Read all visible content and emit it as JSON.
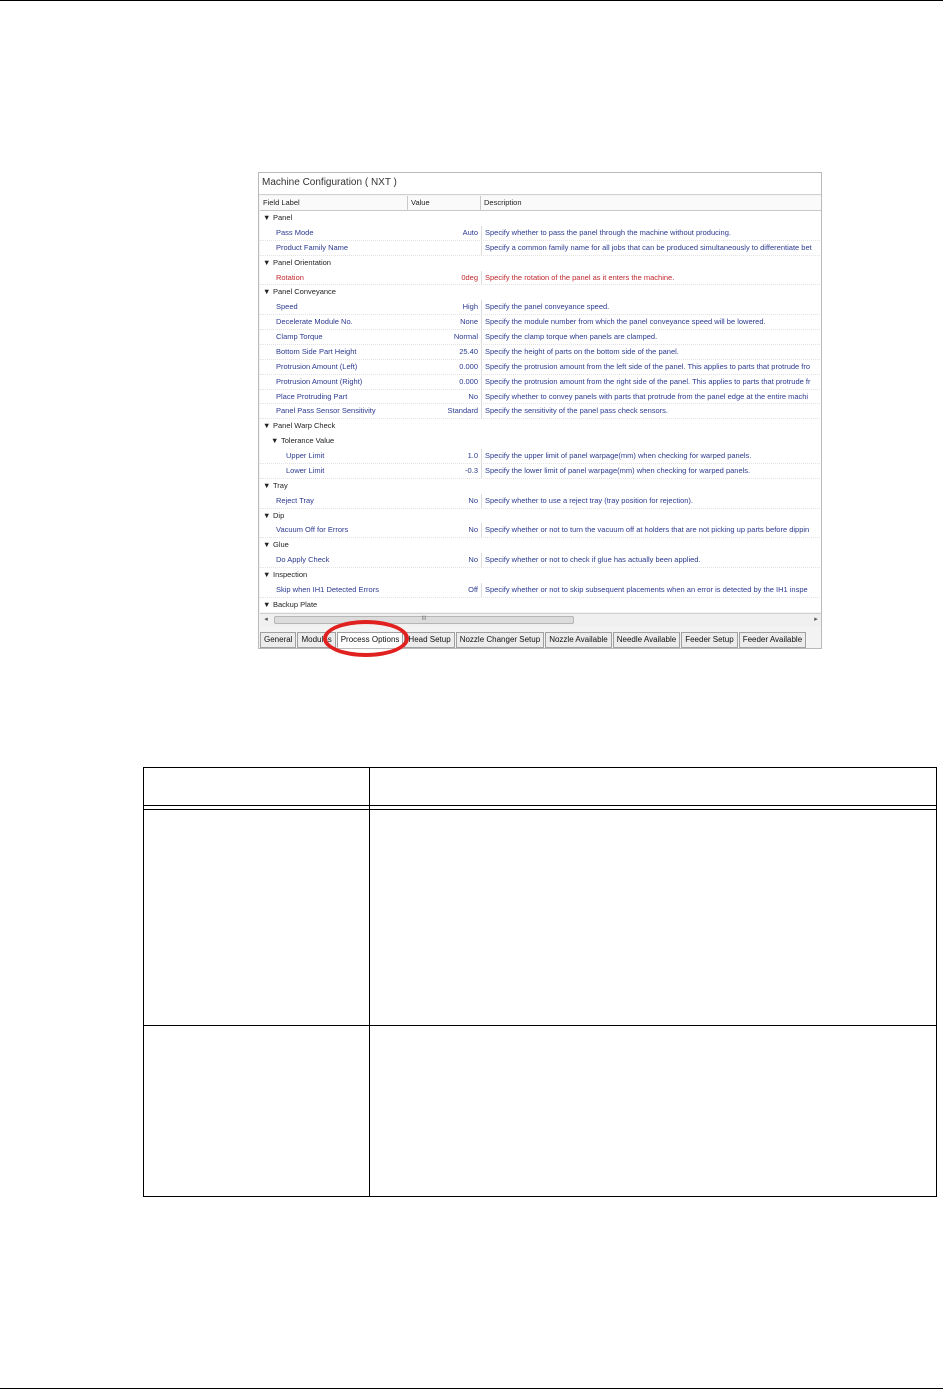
{
  "window": {
    "title": "Machine Configuration ( NXT )",
    "columns": [
      "Field Label",
      "Value",
      "Description"
    ]
  },
  "rows": [
    {
      "type": "category",
      "label": "Panel"
    },
    {
      "type": "property",
      "label": "Pass Mode",
      "value": "Auto",
      "description": "Specify whether to pass the panel through the machine without producing."
    },
    {
      "type": "property",
      "label": "Product Family Name",
      "value": "",
      "description": "Specify a common family name for all jobs that can be produced simultaneously to differentiate bet"
    },
    {
      "type": "category",
      "label": "Panel Orientation"
    },
    {
      "type": "property",
      "label": "Rotation",
      "value": "0deg",
      "description": "Specify the rotation of the panel as it enters the machine.",
      "highlight": true
    },
    {
      "type": "category",
      "label": "Panel Conveyance"
    },
    {
      "type": "property",
      "label": "Speed",
      "value": "High",
      "description": "Specify the panel conveyance speed."
    },
    {
      "type": "property",
      "label": "Decelerate Module No.",
      "value": "None",
      "description": "Specify the module number from which the panel conveyance speed will be lowered."
    },
    {
      "type": "property",
      "label": "Clamp Torque",
      "value": "Normal",
      "description": "Specify the clamp torque when panels are clamped."
    },
    {
      "type": "property",
      "label": "Bottom Side Part Height",
      "value": "25.40",
      "description": "Specify the height of parts on the bottom side of the panel."
    },
    {
      "type": "property",
      "label": "Protrusion Amount (Left)",
      "value": "0.000",
      "description": "Specify the protrusion amount from the left side of the panel. This applies to parts that protrude fro"
    },
    {
      "type": "property",
      "label": "Protrusion Amount (Right)",
      "value": "0.000",
      "description": "Specify the protrusion amount from the right side of the panel. This applies to parts that protrude fr"
    },
    {
      "type": "property",
      "label": "Place Protruding Part",
      "value": "No",
      "description": "Specify whether to convey panels with parts that protrude from the panel edge at the entire machi"
    },
    {
      "type": "property",
      "label": "Panel Pass Sensor Sensitivity",
      "value": "Standard",
      "description": "Specify the sensitivity of the panel pass check sensors."
    },
    {
      "type": "category",
      "label": "Panel Warp Check"
    },
    {
      "type": "subcategory",
      "label": "Tolerance Value"
    },
    {
      "type": "property",
      "level": 2,
      "label": "Upper Limit",
      "value": "1.0",
      "description": "Specify the upper limit of panel warpage(mm) when checking for warped panels."
    },
    {
      "type": "property",
      "level": 2,
      "label": "Lower Limit",
      "value": "-0.3",
      "description": "Specify the lower limit of panel warpage(mm) when checking for warped panels."
    },
    {
      "type": "category",
      "label": "Tray"
    },
    {
      "type": "property",
      "label": "Reject Tray",
      "value": "No",
      "description": "Specify whether to use a reject tray (tray position for rejection)."
    },
    {
      "type": "category",
      "label": "Dip"
    },
    {
      "type": "property",
      "label": "Vacuum Off for Errors",
      "value": "No",
      "description": "Specify whether or not to turn the vacuum off at holders that are not picking up parts before dippin"
    },
    {
      "type": "category",
      "label": "Glue"
    },
    {
      "type": "property",
      "label": "Do Apply Check",
      "value": "No",
      "description": "Specify whether or not to check if glue has actually been applied."
    },
    {
      "type": "category",
      "label": "Inspection"
    },
    {
      "type": "property",
      "label": "Skip when IH1 Detected Errors",
      "value": "Off",
      "description": "Specify whether or not to skip subsequent placements when an error is detected by the IH1 inspe"
    },
    {
      "type": "category",
      "label": "Backup Plate"
    }
  ],
  "scrollbar": {
    "thumb_glyph": "III",
    "left_arrow": "◂",
    "right_arrow": "▸"
  },
  "tabs": [
    {
      "label": "General",
      "active": false
    },
    {
      "label": "Modules",
      "active": false
    },
    {
      "label": "Process Options",
      "active": true
    },
    {
      "label": "Head Setup",
      "active": false
    },
    {
      "label": "Nozzle Changer Setup",
      "active": false
    },
    {
      "label": "Nozzle Available",
      "active": false
    },
    {
      "label": "Needle Available",
      "active": false
    },
    {
      "label": "Feeder Setup",
      "active": false
    },
    {
      "label": "Feeder Available",
      "active": false
    }
  ],
  "colors": {
    "label_text": "#2b3a8f",
    "highlight": "#c0272d",
    "annotation_ring": "#e0211f"
  }
}
